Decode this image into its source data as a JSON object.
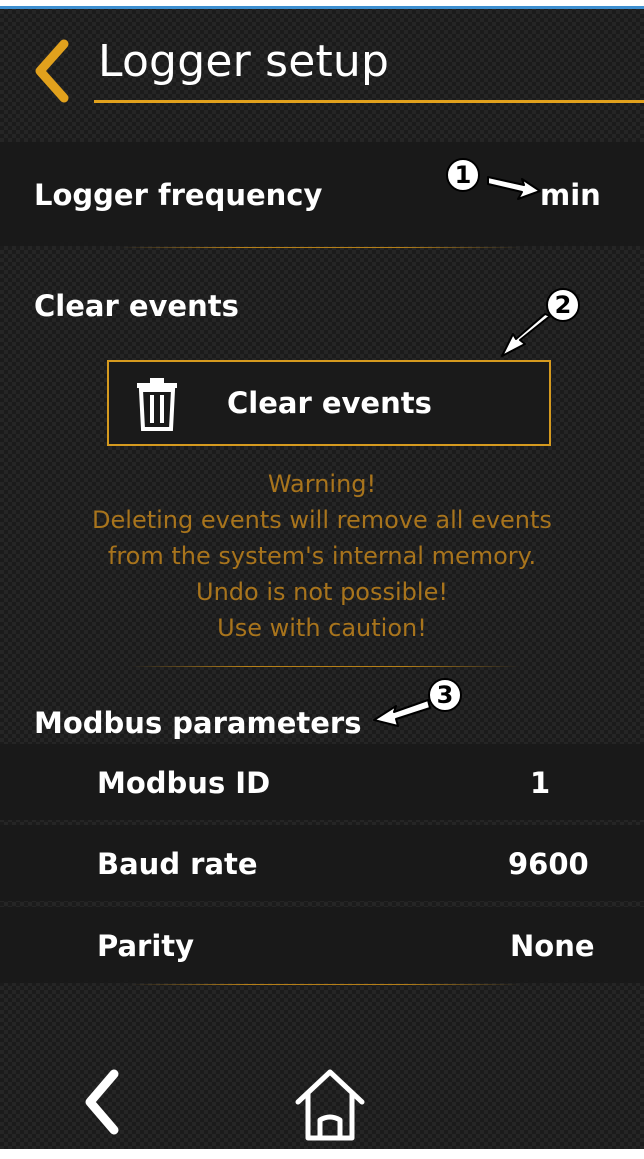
{
  "header": {
    "title": "Logger setup",
    "back_icon": "chevron-left-icon"
  },
  "logger_frequency": {
    "label": "Logger frequency",
    "value": "min"
  },
  "clear_events": {
    "section_title": "Clear events",
    "button_label": "Clear events",
    "button_icon": "trash-icon",
    "warning_lines": [
      "Warning!",
      "Deleting events will remove all events",
      "from the system's internal memory.",
      "Undo is not possible!",
      "Use with caution!"
    ]
  },
  "modbus": {
    "section_title": "Modbus parameters",
    "rows": [
      {
        "label": "Modbus ID",
        "value": "1"
      },
      {
        "label": "Baud rate",
        "value": "9600"
      },
      {
        "label": "Parity",
        "value": "None"
      }
    ]
  },
  "callouts": [
    "1",
    "2",
    "3"
  ],
  "bottom_nav": {
    "back_icon": "chevron-left-icon",
    "home_icon": "home-icon"
  },
  "colors": {
    "accent": "#e1a11d",
    "warning_text": "#a8741c",
    "top_bar": "#3d8fd0"
  }
}
